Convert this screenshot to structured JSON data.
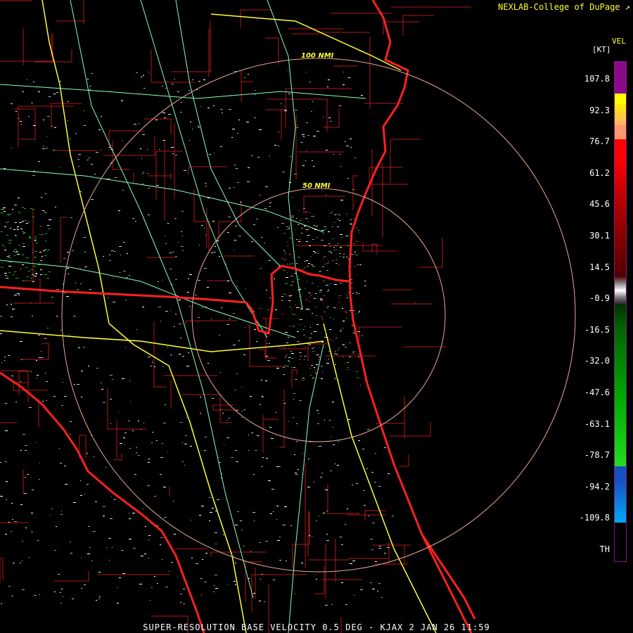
{
  "credit": "NEXLAB-College of DuPage",
  "legend": {
    "title": "VEL",
    "unit": "[KT]",
    "ticks": [
      "107.8",
      "92.3",
      "76.7",
      "61.2",
      "45.6",
      "30.1",
      "14.5",
      "-0.9",
      "-16.5",
      "-32.0",
      "-47.6",
      "-63.1",
      "-78.7",
      "-94.2",
      "-109.8",
      "TH"
    ]
  },
  "range_rings": {
    "inner": "50 NMI",
    "outer": "100 NMI"
  },
  "footer": "SUPER-RESOLUTION BASE VELOCITY 0.5 DEG - KJAX 2 JAN 26 11:59",
  "colors": {
    "state_border": "#ff2020",
    "county_border": "#b01818",
    "highway": "#ffff33",
    "road": "#88ffbb",
    "ring": "#e8a898"
  }
}
